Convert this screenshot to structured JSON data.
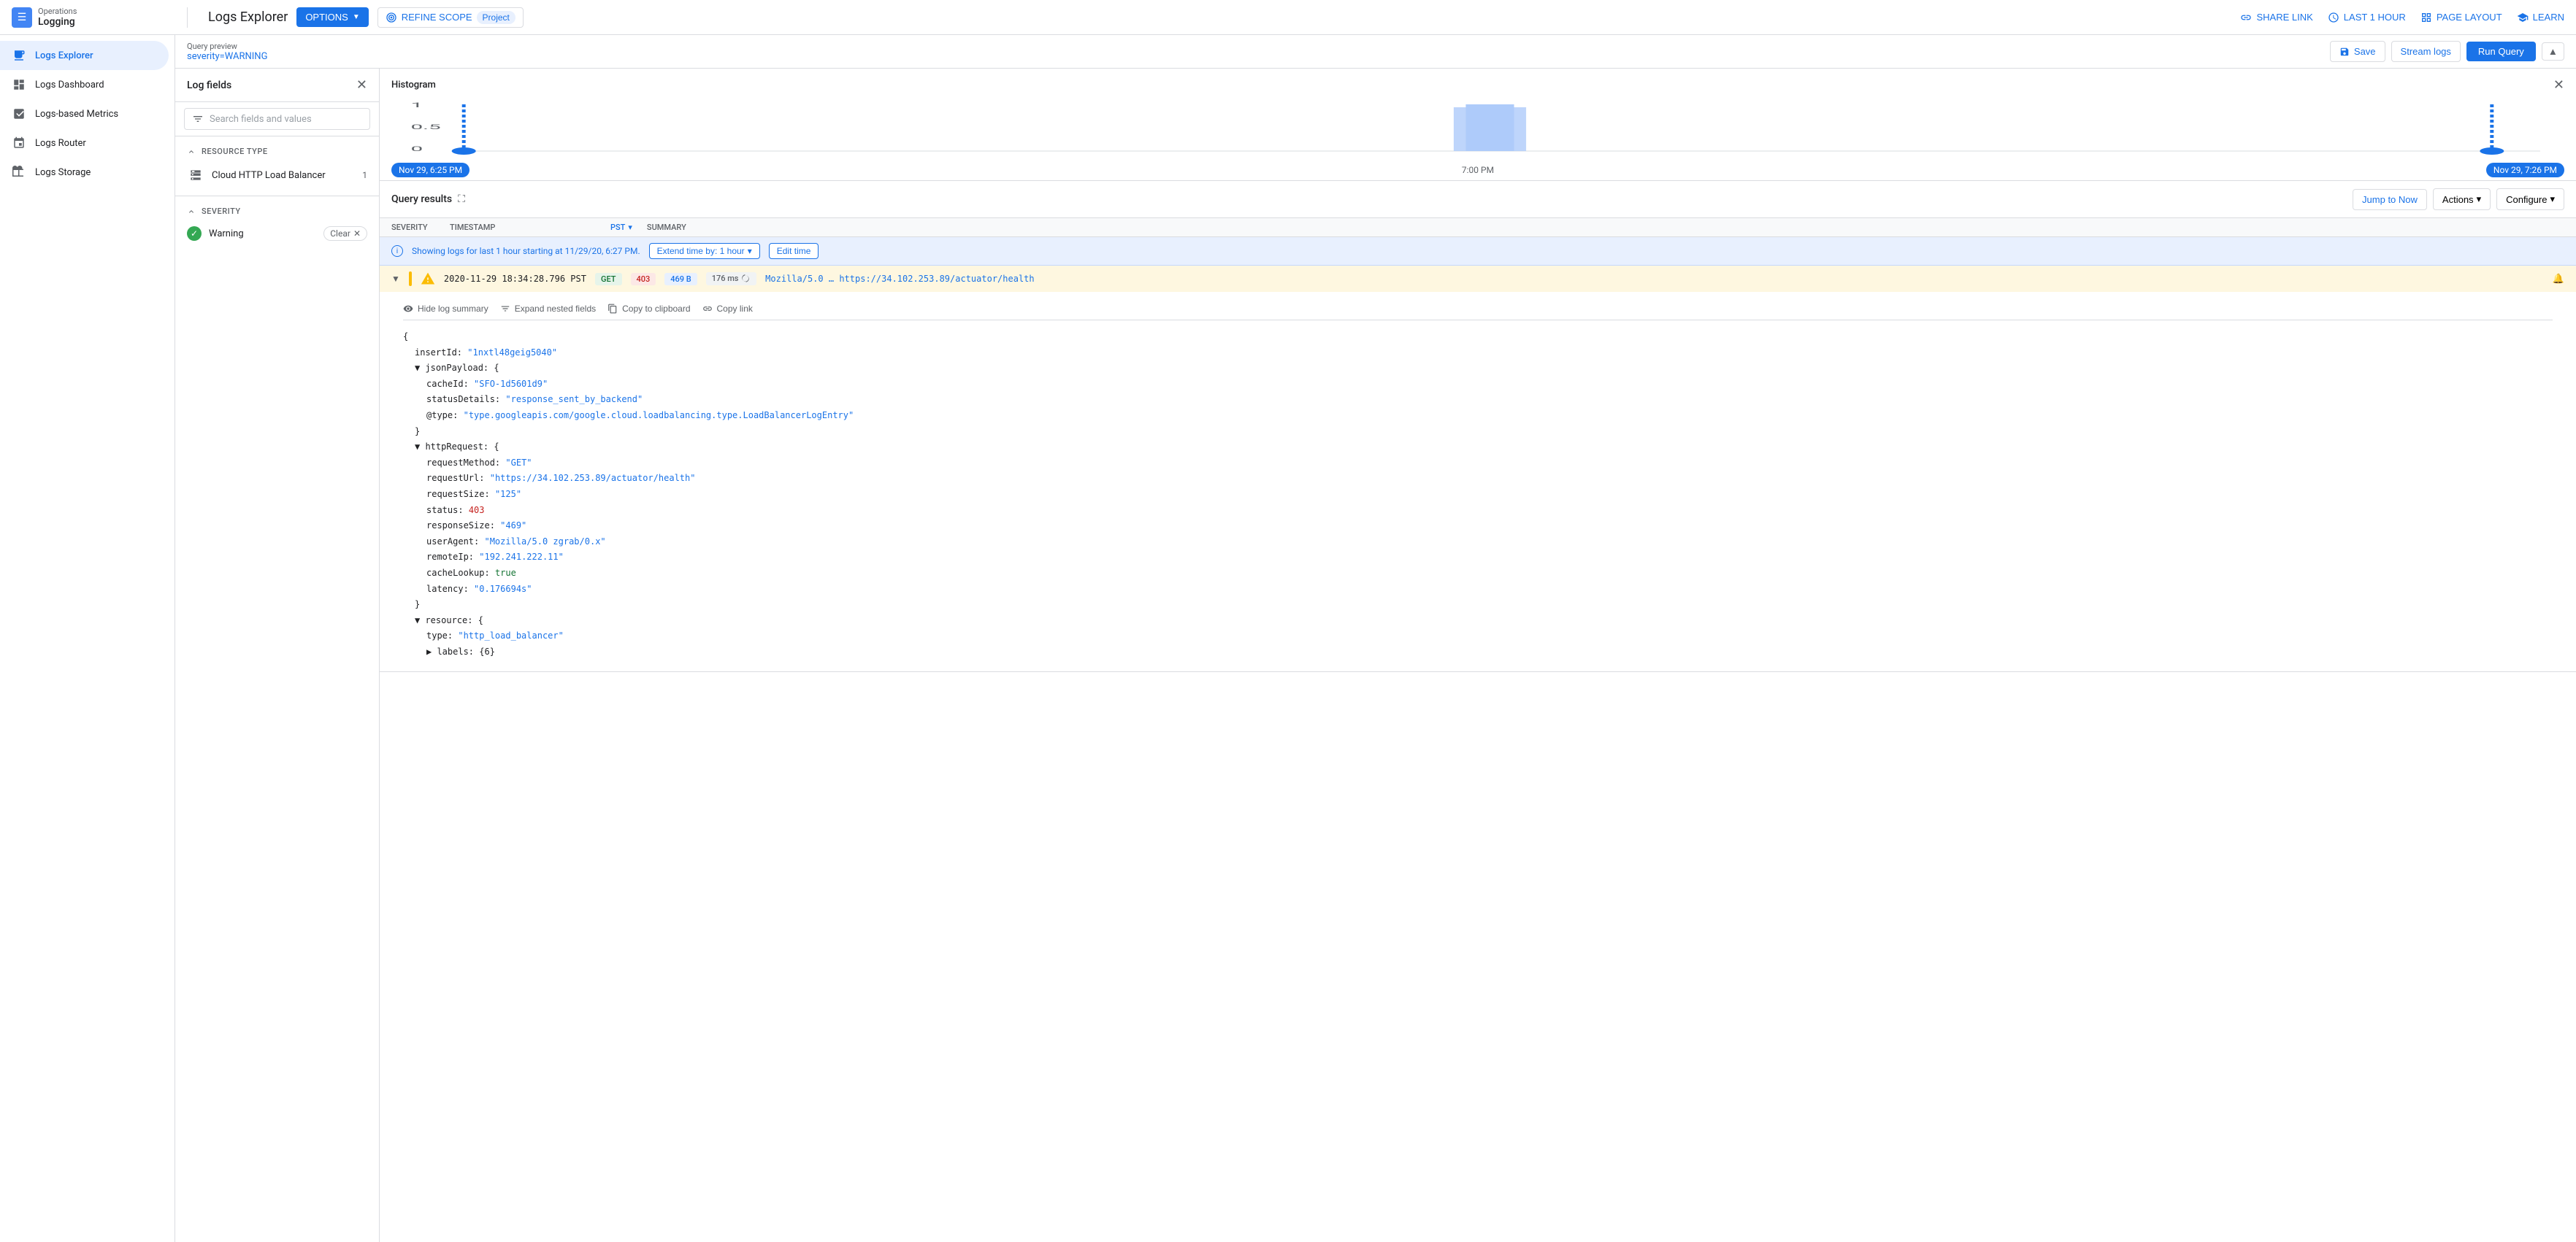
{
  "app": {
    "title": "Operations Logging",
    "ops_label": "Operations",
    "logging_label": "Logging"
  },
  "top_nav": {
    "page_title": "Logs Explorer",
    "options_btn": "OPTIONS",
    "refine_scope_btn": "REFINE SCOPE",
    "project_badge": "Project",
    "share_link": "SHARE LINK",
    "last_1_hour": "LAST 1 HOUR",
    "page_layout": "PAGE LAYOUT",
    "learn": "LEARN"
  },
  "query_preview": {
    "label": "Query preview",
    "value": "severity=WARNING",
    "save_btn": "Save",
    "stream_btn": "Stream logs",
    "run_btn": "Run Query"
  },
  "sidebar": {
    "items": [
      {
        "id": "logs-explorer",
        "label": "Logs Explorer",
        "active": true
      },
      {
        "id": "logs-dashboard",
        "label": "Logs Dashboard",
        "active": false
      },
      {
        "id": "logs-based-metrics",
        "label": "Logs-based Metrics",
        "active": false
      },
      {
        "id": "logs-router",
        "label": "Logs Router",
        "active": false
      },
      {
        "id": "logs-storage",
        "label": "Logs Storage",
        "active": false
      }
    ]
  },
  "log_fields": {
    "title": "Log fields",
    "search_placeholder": "Search fields and values",
    "resource_type_label": "RESOURCE TYPE",
    "cloud_http_lb": "Cloud HTTP Load Balancer",
    "cloud_http_lb_count": "1",
    "severity_label": "SEVERITY",
    "warning_label": "Warning",
    "clear_btn": "Clear"
  },
  "histogram": {
    "title": "Histogram",
    "y_max": "1",
    "y_mid": "0.5",
    "y_min": "0",
    "time_start": "Nov 29, 6:25 PM",
    "time_mid": "7:00 PM",
    "time_end": "Nov 29, 7:26 PM"
  },
  "query_results": {
    "title": "Query results",
    "jump_now_btn": "Jump to Now",
    "actions_btn": "Actions",
    "configure_btn": "Configure",
    "info_text": "Showing logs for last 1 hour starting at 11/29/20, 6:27 PM.",
    "extend_btn": "Extend time by: 1 hour",
    "edit_time_btn": "Edit time",
    "col_severity": "SEVERITY",
    "col_timestamp": "TIMESTAMP",
    "col_pst": "PST",
    "col_summary": "SUMMARY"
  },
  "log_entry": {
    "timestamp": "2020-11-29 18:34:28.796 PST",
    "method": "GET",
    "status": "403",
    "size": "469 B",
    "latency": "176 ms",
    "summary": "Mozilla/5.0 …  https://34.102.253.89/actuator/health",
    "insert_id_key": "insertId:",
    "insert_id_val": "\"1nxtl48geig5040\"",
    "json_payload_key": "jsonPayload: {",
    "cache_id_key": "cacheId:",
    "cache_id_val": "\"SFO-1d5601d9\"",
    "status_details_key": "statusDetails:",
    "status_details_val": "\"response_sent_by_backend\"",
    "type_key": "@type:",
    "type_val": "\"type.googleapis.com/google.cloud.loadbalancing.type.LoadBalancerLogEntry\"",
    "http_request_key": "httpRequest: {",
    "req_method_key": "requestMethod:",
    "req_method_val": "\"GET\"",
    "req_url_key": "requestUrl:",
    "req_url_val": "\"https://34.102.253.89/actuator/health\"",
    "req_size_key": "requestSize:",
    "req_size_val": "\"125\"",
    "status_key": "status:",
    "status_val": "403",
    "resp_size_key": "responseSize:",
    "resp_size_val": "\"469\"",
    "user_agent_key": "userAgent:",
    "user_agent_val": "\"Mozilla/5.0 zgrab/0.x\"",
    "remote_ip_key": "remoteIp:",
    "remote_ip_val": "\"192.241.222.11\"",
    "cache_lookup_key": "cacheLookup:",
    "cache_lookup_val": "true",
    "latency_key": "latency:",
    "latency_val": "\"0.176694s\"",
    "resource_key": "resource: {",
    "type_res_key": "type:",
    "type_res_val": "\"http_load_balancer\"",
    "labels_key": "labels: {6}",
    "hide_log_summary": "Hide log summary",
    "expand_nested": "Expand nested fields",
    "copy_clipboard": "Copy to clipboard",
    "copy_link": "Copy link"
  }
}
